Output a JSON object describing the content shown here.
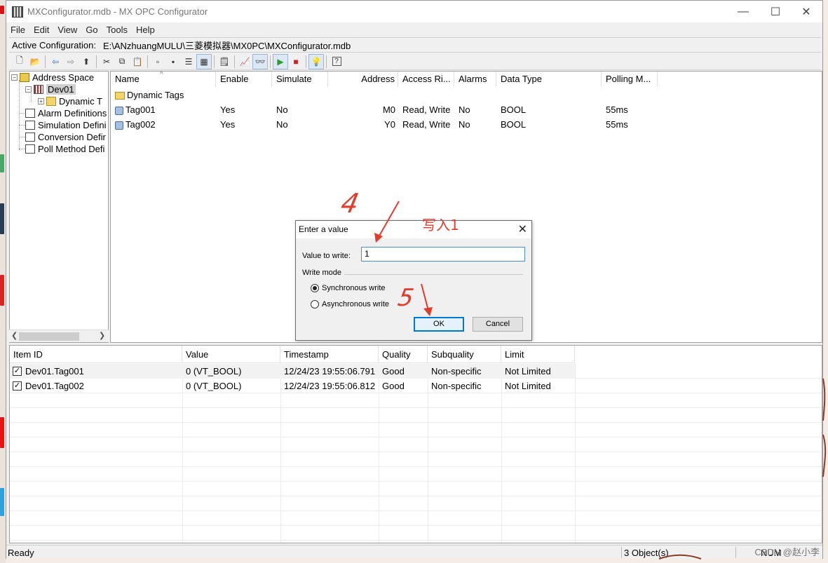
{
  "window": {
    "title": "MXConfigurator.mdb - MX OPC Configurator",
    "minimize_glyph": "—",
    "maximize_glyph": "☐",
    "close_glyph": "✕"
  },
  "menu": {
    "items": [
      {
        "label": "File"
      },
      {
        "label": "Edit"
      },
      {
        "label": "View"
      },
      {
        "label": "Go"
      },
      {
        "label": "Tools"
      },
      {
        "label": "Help"
      }
    ]
  },
  "active_config": {
    "label": "Active Configuration:",
    "path": "E:\\ANzhuangMULU\\三菱模拟器\\MX0PC\\MXConfigurator.mdb"
  },
  "toolbar": {
    "buttons": [
      {
        "icon": "new-icon",
        "glyph": "🗋"
      },
      {
        "icon": "open-icon",
        "glyph": "📂"
      },
      {
        "icon": "back-icon",
        "glyph": "⇦"
      },
      {
        "icon": "forward-icon",
        "glyph": "⇨"
      },
      {
        "icon": "up-folder-icon",
        "glyph": "⬆"
      },
      {
        "icon": "cut-icon",
        "glyph": "✂"
      },
      {
        "icon": "copy-icon",
        "glyph": "⧉"
      },
      {
        "icon": "paste-icon",
        "glyph": "📋"
      },
      {
        "icon": "large-icons-icon",
        "glyph": "▫"
      },
      {
        "icon": "small-icons-icon",
        "glyph": "▪"
      },
      {
        "icon": "list-icon",
        "glyph": "☰"
      },
      {
        "icon": "details-icon",
        "glyph": "▦"
      },
      {
        "icon": "properties-icon",
        "glyph": "🗒"
      },
      {
        "icon": "monitor-icon",
        "glyph": "📈"
      },
      {
        "icon": "view-tags-icon",
        "glyph": "👓"
      },
      {
        "icon": "start-icon",
        "glyph": "▶",
        "color": "#2a9d2a"
      },
      {
        "icon": "stop-icon",
        "glyph": "■",
        "color": "#d42020"
      },
      {
        "icon": "lightbulb-icon",
        "glyph": "💡"
      },
      {
        "icon": "help-icon",
        "glyph": "?"
      }
    ]
  },
  "tree": {
    "root": "Address Space",
    "device": "Dev01",
    "dynamic": "Dynamic T",
    "alarm": "Alarm Definitions",
    "simulation": "Simulation Defini",
    "conversion": "Conversion Defir",
    "poll": "Poll Method Defi"
  },
  "listview": {
    "columns": [
      "Name",
      "Enable",
      "Simulate",
      "Address",
      "Access Ri...",
      "Alarms",
      "Data Type",
      "Polling M..."
    ],
    "folder_row": "Dynamic Tags",
    "rows": [
      {
        "name": "Tag001",
        "enable": "Yes",
        "simulate": "No",
        "address": "M0",
        "access": "Read, Write",
        "alarms": "No",
        "type": "BOOL",
        "polling": "55ms"
      },
      {
        "name": "Tag002",
        "enable": "Yes",
        "simulate": "No",
        "address": "Y0",
        "access": "Read, Write",
        "alarms": "No",
        "type": "BOOL",
        "polling": "55ms"
      }
    ]
  },
  "monitor": {
    "columns": [
      "Item ID",
      "Value",
      "Timestamp",
      "Quality",
      "Subquality",
      "Limit"
    ],
    "rows": [
      {
        "id": "Dev01.Tag001",
        "value": "0 (VT_BOOL)",
        "ts": "12/24/23 19:55:06.791",
        "quality": "Good",
        "subquality": "Non-specific",
        "limit": "Not Limited",
        "checked": true
      },
      {
        "id": "Dev01.Tag002",
        "value": "0 (VT_BOOL)",
        "ts": "12/24/23 19:55:06.812",
        "quality": "Good",
        "subquality": "Non-specific",
        "limit": "Not Limited",
        "checked": true
      }
    ]
  },
  "status": {
    "left": "Ready",
    "objects": "3 Object(s)",
    "num": "NUM"
  },
  "dialog": {
    "title": "Enter a value",
    "value_label": "Value to write:",
    "value": "1",
    "mode_label": "Write mode",
    "sync": "Synchronous write",
    "async": "Asynchronous write",
    "ok": "OK",
    "cancel": "Cancel",
    "selected_mode": "sync"
  },
  "annotations": {
    "step4": "4",
    "write1": "写入1",
    "step5": "5",
    "color": "#e43a2b"
  },
  "watermark": "CSDN @赵小李"
}
